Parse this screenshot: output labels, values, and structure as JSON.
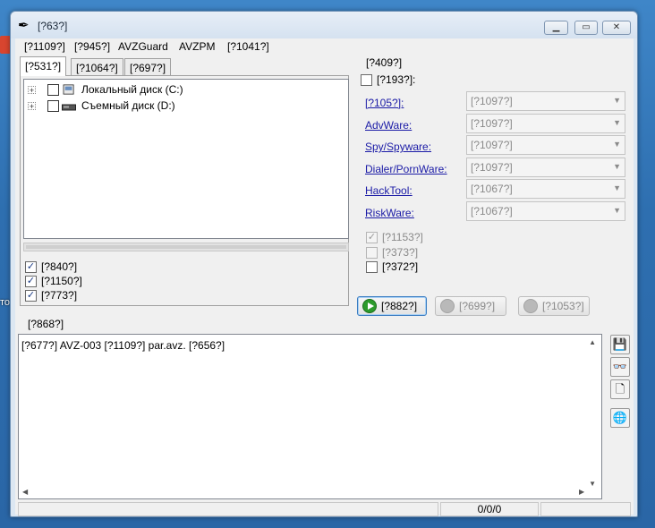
{
  "window": {
    "title": "[?63?]"
  },
  "menu": [
    "[?1109?]",
    "[?945?]",
    "AVZGuard",
    "AVZPM",
    "[?1041?]"
  ],
  "tabs": [
    "[?531?]",
    "[?1064?]",
    "[?697?]"
  ],
  "tree": [
    {
      "label": "Локальный диск (C:)",
      "icon": "hard-drive-icon"
    },
    {
      "label": "Съемный диск (D:)",
      "icon": "removable-drive-icon"
    }
  ],
  "scan_options": [
    {
      "label": "[?840?]",
      "checked": true
    },
    {
      "label": "[?1150?]",
      "checked": true
    },
    {
      "label": "[?773?]",
      "checked": true
    }
  ],
  "group": {
    "caption": "[?409?]",
    "top_checkbox": {
      "label": "[?193?]:",
      "checked": false
    },
    "categories": [
      {
        "label": "[?105?]:",
        "value": "[?1097?]"
      },
      {
        "label": "AdvWare:",
        "value": "[?1097?]"
      },
      {
        "label": "Spy/Spyware:",
        "value": "[?1097?]"
      },
      {
        "label": "Dialer/PornWare:",
        "value": "[?1097?]"
      },
      {
        "label": "HackTool:",
        "value": "[?1067?]"
      },
      {
        "label": "RiskWare:",
        "value": "[?1067?]"
      }
    ],
    "sub_options": [
      {
        "label": "[?1153?]",
        "checked": true,
        "disabled": true
      },
      {
        "label": "[?373?]",
        "checked": false,
        "disabled": true
      },
      {
        "label": "[?372?]",
        "checked": false,
        "disabled": false
      }
    ]
  },
  "buttons": {
    "start": "[?882?]",
    "pause": "[?699?]",
    "stop": "[?1053?]"
  },
  "log": {
    "caption": "[?868?]",
    "text": "[?677?] AVZ-003 [?1109?] par.avz. [?656?]"
  },
  "tools": [
    "save-icon",
    "glasses-icon",
    "new-document-icon",
    "globe-icon"
  ],
  "status": {
    "counter": "0/0/0"
  },
  "desktop": {
    "icon_label": "то"
  }
}
